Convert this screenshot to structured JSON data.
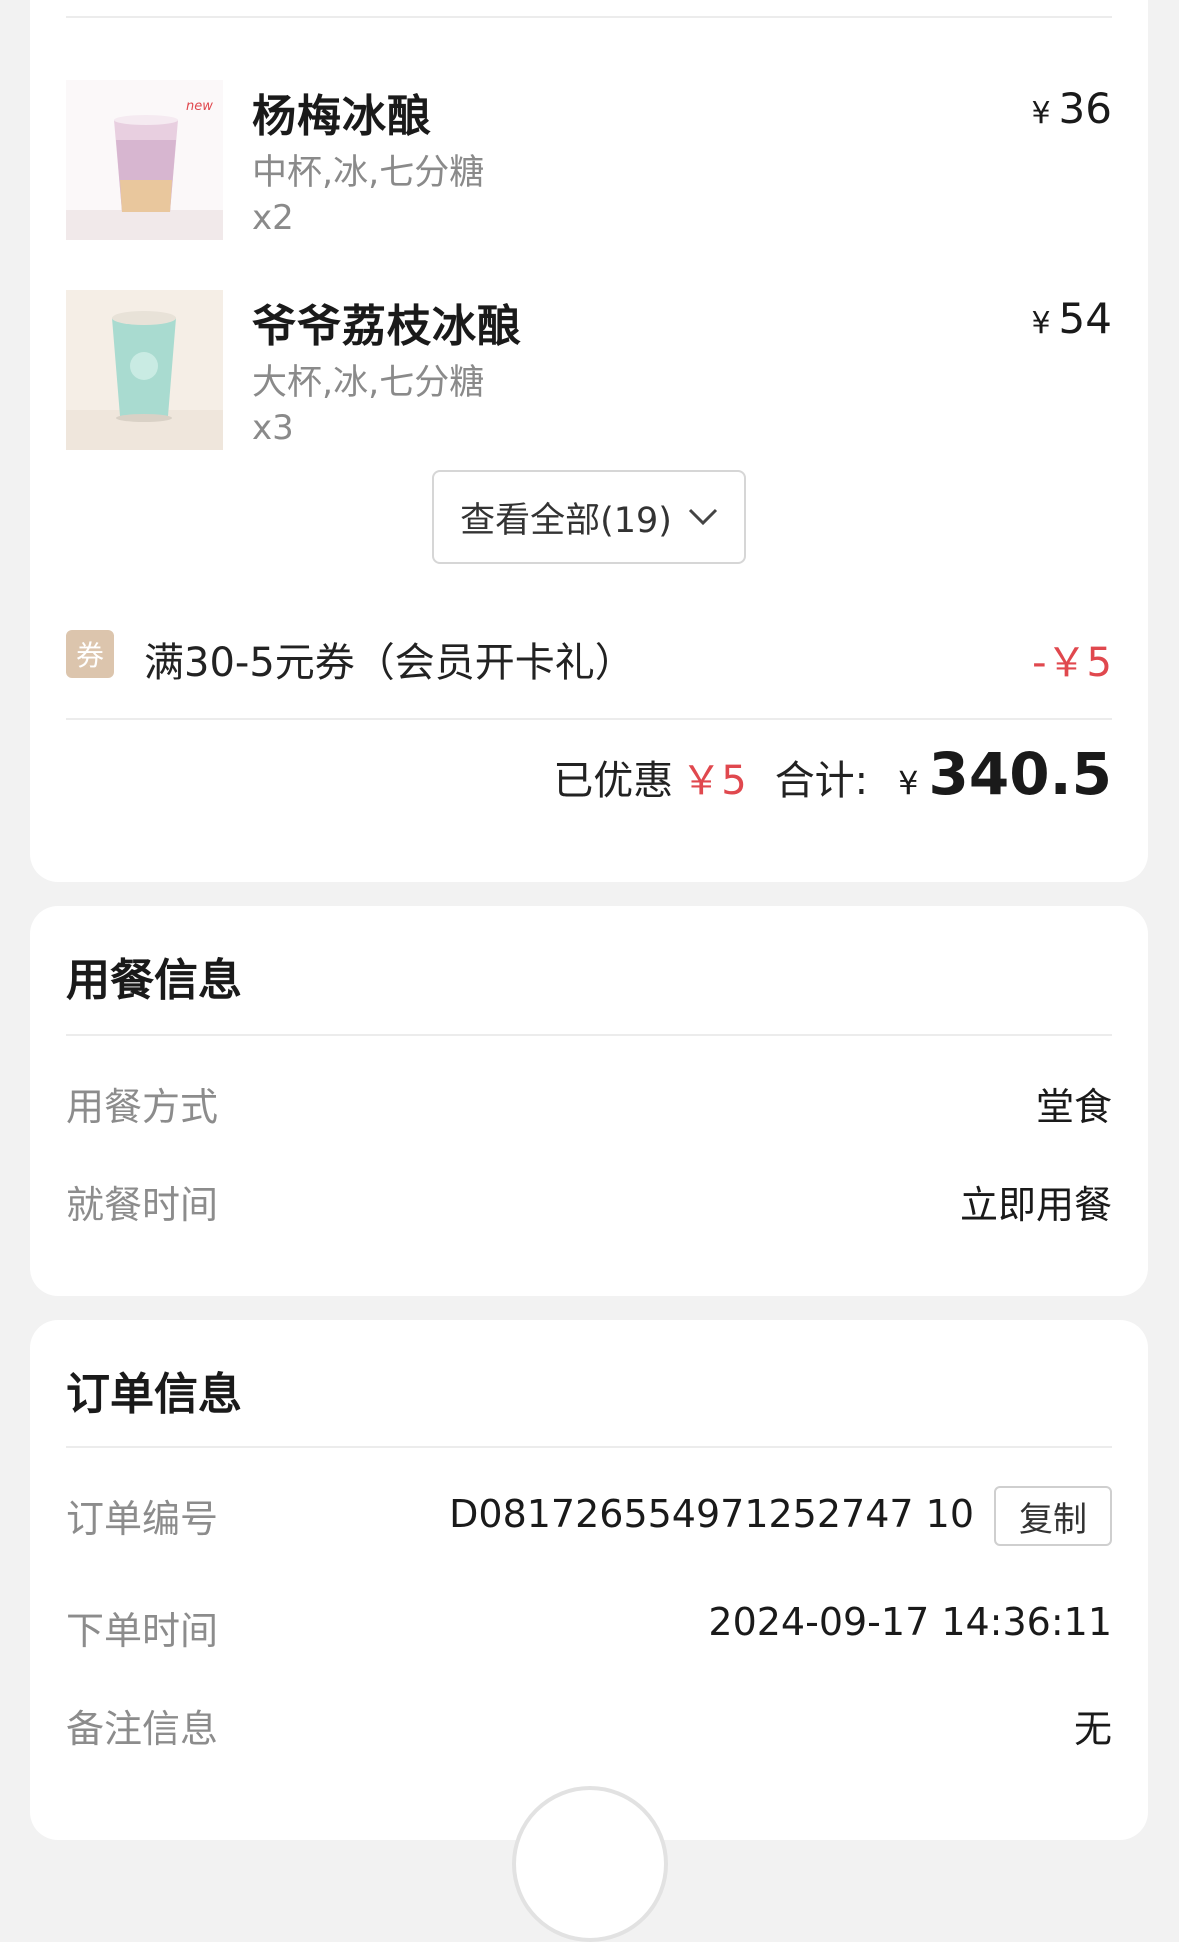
{
  "items": [
    {
      "name": "杨梅冰酿",
      "spec": "中杯,冰,七分糖",
      "qty": "x2",
      "currency": "¥",
      "price": "36",
      "thumb_label": "new"
    },
    {
      "name": "爷爷荔枝冰酿",
      "spec": "大杯,冰,七分糖",
      "qty": "x3",
      "currency": "¥",
      "price": "54"
    }
  ],
  "view_all": {
    "label": "查看全部(19)"
  },
  "coupon": {
    "badge": "券",
    "text": "满30-5元券（会员开卡礼）",
    "amount": "-￥5"
  },
  "summary": {
    "discount_label": "已优惠",
    "discount_value": "￥5",
    "total_label": "合计:",
    "currency": "¥",
    "total": "340.5"
  },
  "dining": {
    "title": "用餐信息",
    "rows": [
      {
        "label": "用餐方式",
        "value": "堂食"
      },
      {
        "label": "就餐时间",
        "value": "立即用餐"
      }
    ]
  },
  "order": {
    "title": "订单信息",
    "rows": [
      {
        "label": "订单编号",
        "value": "D081726554971252747 10"
      },
      {
        "label": "下单时间",
        "value": "2024-09-17 14:36:11"
      },
      {
        "label": "备注信息",
        "value": "无"
      }
    ],
    "copy_label": "复制"
  },
  "colors": {
    "accent_red": "#e0484e",
    "coupon_badge": "#dcc5ad"
  }
}
